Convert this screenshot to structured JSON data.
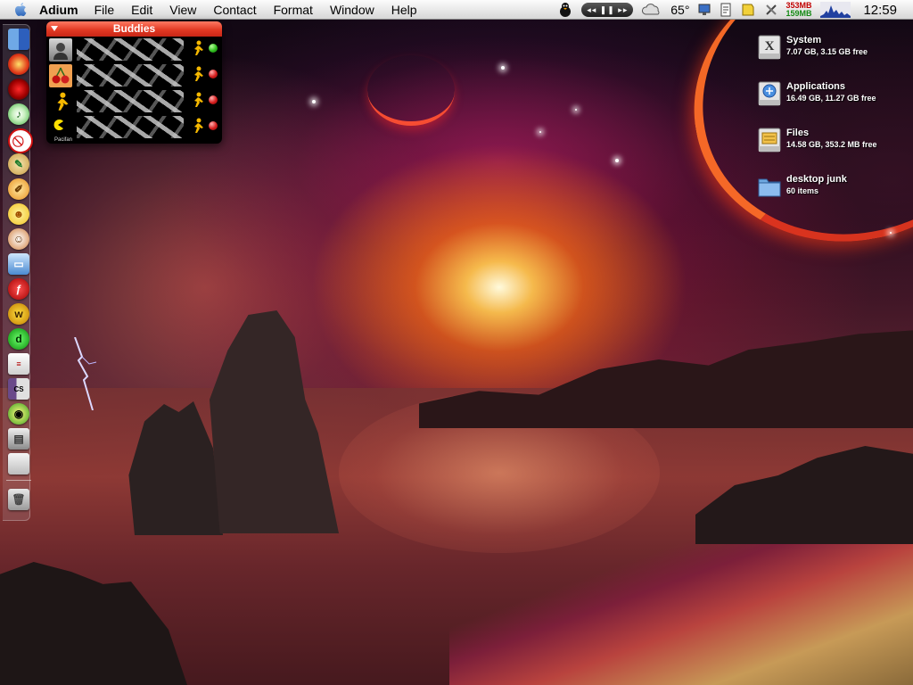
{
  "menubar": {
    "app_name": "Adium",
    "items": [
      "File",
      "Edit",
      "View",
      "Contact",
      "Format",
      "Window",
      "Help"
    ],
    "temperature": "65°",
    "mem_used": "353MB",
    "mem_free": "159MB",
    "clock": "12:59"
  },
  "buddy_list": {
    "title": "Buddies",
    "status_label": "Pacifan",
    "statuses": [
      "green",
      "red",
      "red",
      "red"
    ]
  },
  "desktop_items": [
    {
      "name": "System",
      "info": "7.07 GB, 3.15 GB free",
      "icon": "os-x-disk-icon"
    },
    {
      "name": "Applications",
      "info": "16.49 GB, 11.27 GB free",
      "icon": "applications-disk-icon"
    },
    {
      "name": "Files",
      "info": "14.58 GB, 353.2 MB free",
      "icon": "files-disk-icon"
    },
    {
      "name": "desktop junk",
      "info": "60 items",
      "icon": "folder-icon"
    }
  ],
  "colors": {
    "menubar_top": "#fcfcfc",
    "buddies_titlebar": "#e23a24",
    "mem_used": "#c10000",
    "mem_free": "#148a14"
  }
}
